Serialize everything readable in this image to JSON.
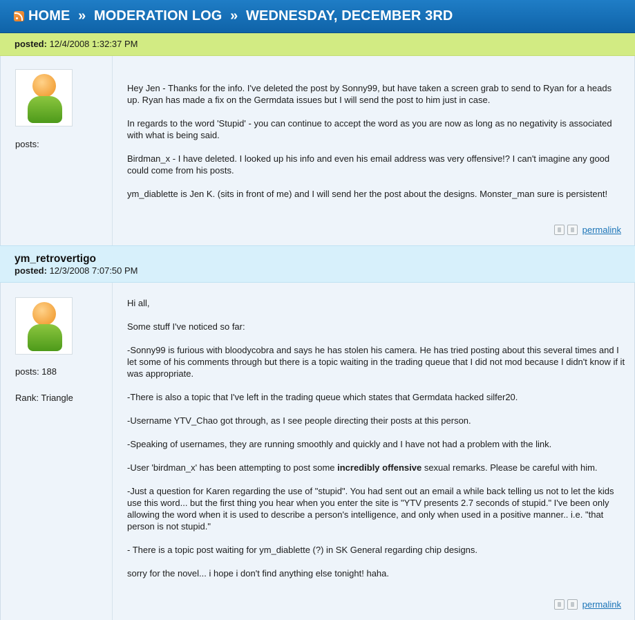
{
  "breadcrumb": {
    "home": "HOME",
    "separator": "»",
    "section": "MODERATION LOG",
    "page": "WEDNESDAY, DECEMBER 3RD"
  },
  "posts": [
    {
      "author": "",
      "posted_label": "posted:",
      "posted_time": "12/4/2008 1:32:37 PM",
      "stats": {
        "posts_label": "posts:"
      },
      "paragraphs": [
        "Hey Jen - Thanks for the info. I've deleted the post by Sonny99, but have taken a screen grab to send to Ryan for a heads up. Ryan has made a fix on the Germdata issues but I will send the post to him just in case.",
        "In regards to the word 'Stupid' - you can continue to accept the word as you are now as long as no negativity is associated with what is being said.",
        "Birdman_x - I have deleted. I looked up his info and even his email address was very offensive!? I can't imagine any good could come from his posts.",
        "ym_diablette is Jen K. (sits in front of me) and I will send her the post about the designs. Monster_man sure is persistent!"
      ],
      "permalink": "permalink"
    },
    {
      "author": "ym_retrovertigo",
      "posted_label": "posted:",
      "posted_time": "12/3/2008 7:07:50 PM",
      "stats": {
        "posts_label": "posts: 188",
        "rank_label": "Rank: Triangle"
      },
      "paragraphs": [
        "Hi all,",
        "Some stuff I've noticed so far:",
        "-Sonny99 is furious with bloodycobra and says he has stolen his camera. He has tried posting about this several times and I let some of his comments through but there is a topic waiting in the trading queue that I did not mod because I didn't know if it was appropriate.",
        "-There is also a topic that I've left in the trading queue which states that Germdata hacked silfer20.",
        "-Username YTV_Chao got through, as I see people directing their posts at this person.",
        "-Speaking of usernames, they are running smoothly and quickly and I have not had a problem with the link.",
        "-Just a question for Karen regarding the use of \"stupid\". You had sent out an email a while back telling us not to let the kids use this word... but the first thing you hear when you enter the site is \"YTV presents 2.7 seconds of stupid.\" I've been only allowing the word when it is used to describe a person's intelligence, and only when used in a positive manner.. i.e. \"that person is not stupid.\"",
        "- There is a topic post waiting for ym_diablette (?) in SK General regarding chip designs.",
        "sorry for the novel... i hope i don't find anything else tonight! haha."
      ],
      "birdman_pre": "-User 'birdman_x' has been attempting to post some ",
      "birdman_bold": "incredibly offensive",
      "birdman_post": " sexual remarks. Please be careful with him.",
      "permalink": "permalink"
    }
  ],
  "icons": {
    "rss": "rss-icon",
    "thumbs_up": "thumbs-up-icon",
    "thumbs_down": "thumbs-down-icon",
    "avatar": "default-avatar"
  }
}
